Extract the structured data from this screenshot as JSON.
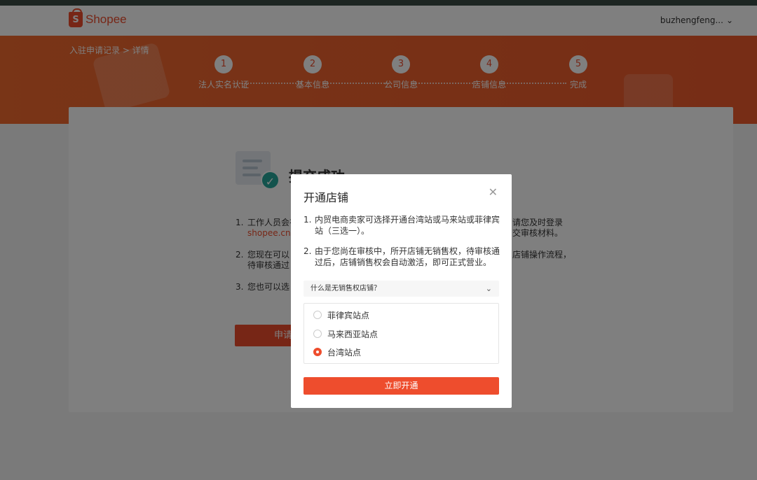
{
  "header": {
    "brand": "Shopee",
    "logo_letter": "S",
    "username": "buzhengfeng...",
    "user_chevron": "⌄"
  },
  "banner": {
    "breadcrumb": "入驻申请记录 > 详情",
    "steps": [
      {
        "num": "1",
        "label": "法人实名认证"
      },
      {
        "num": "2",
        "label": "基本信息"
      },
      {
        "num": "3",
        "label": "公司信息"
      },
      {
        "num": "4",
        "label": "店铺信息"
      },
      {
        "num": "5",
        "label": "完成"
      }
    ]
  },
  "card": {
    "title": "提交成功",
    "items": [
      {
        "num": "1.",
        "text": "工作人员会在",
        "link": "shopee.cn",
        "right_line1": "请您及时登录",
        "right_line2": "交审核材料。"
      },
      {
        "num": "2.",
        "text_line1": "您现在可以",
        "text_line2": "待审核通过",
        "right_line1": "店铺操作流程，"
      },
      {
        "num": "3.",
        "text": "您也可以选"
      }
    ],
    "apply_button": "申请"
  },
  "modal": {
    "title": "开通店铺",
    "close": "✕",
    "list": [
      {
        "num": "1.",
        "text": "内贸电商卖家可选择开通台湾站或马来站或菲律宾站（三选一）。"
      },
      {
        "num": "2.",
        "text": "由于您尚在审核中，所开店铺无销售权，待审核通过后，店铺销售权会自动激活，即可正式营业。"
      }
    ],
    "faq": "什么是无销售权店铺？",
    "faq_chevron": "⌄",
    "options": [
      {
        "label": "菲律宾站点",
        "selected": false
      },
      {
        "label": "马来西亚站点",
        "selected": false
      },
      {
        "label": "台湾站点",
        "selected": true
      }
    ],
    "confirm_button": "立即开通"
  },
  "colors": {
    "accent": "#ee4d2d",
    "success": "#26a69a"
  }
}
